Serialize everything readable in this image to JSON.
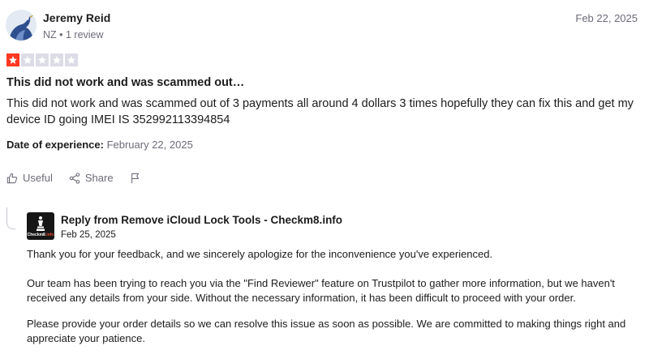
{
  "reviewer": {
    "name": "Jeremy Reid",
    "meta": "NZ • 1 review",
    "avatar_icon": "bird-avatar-icon"
  },
  "review": {
    "date": "Feb 22, 2025",
    "rating": 1,
    "max_rating": 5,
    "title": "This did not work and was scammed out…",
    "body": "This did not work and was scammed out of 3 payments all around 4 dollars 3 times hopefully they can fix this and get my device ID going IMEI IS 352992113394854",
    "experience_label": "Date of experience:",
    "experience_date": "February 22, 2025"
  },
  "actions": {
    "useful_label": "Useful",
    "share_label": "Share",
    "useful_icon": "thumbs-up-icon",
    "share_icon": "share-icon",
    "flag_icon": "flag-icon"
  },
  "reply": {
    "from": "Reply from Remove iCloud Lock Tools - Checkm8.info",
    "date": "Feb 25, 2025",
    "logo_text_a": "Checkm8",
    "logo_text_b": ".info",
    "paragraphs": [
      "Thank you for your feedback, and we sincerely apologize for the inconvenience you've experienced.",
      "Our team has been trying to reach you via the \"Find Reviewer\" feature on Trustpilot to gather more information, but we haven't received any details from your side. Without the necessary information, it has been difficult to proceed with your order.",
      "Please provide your order details so we can resolve this issue as soon as possible. We are committed to making things right and appreciate your patience."
    ]
  },
  "colors": {
    "star_on": "#ff3722",
    "star_off": "#dcdce6",
    "muted_text": "#6b6b78",
    "text": "#1c1c1c"
  }
}
